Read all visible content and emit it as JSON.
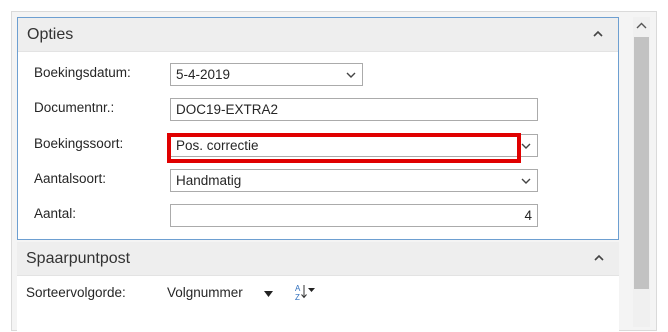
{
  "opties": {
    "title": "Opties",
    "fields": {
      "boekingsdatum": {
        "label": "Boekingsdatum:",
        "value": "5-4-2019"
      },
      "documentnr": {
        "label": "Documentnr.:",
        "value": "DOC19-EXTRA2"
      },
      "boekingssoort": {
        "label": "Boekingssoort:",
        "value": "Pos. correctie"
      },
      "aantalsoort": {
        "label": "Aantalsoort:",
        "value": "Handmatig"
      },
      "aantal": {
        "label": "Aantal:",
        "value": "4"
      }
    }
  },
  "spaarpuntpost": {
    "title": "Spaarpuntpost",
    "sort_label": "Sorteervolgorde:",
    "sort_value": "Volgnummer"
  },
  "icons": {
    "collapse": "chevron-up-icon",
    "dropdown": "chevron-down-icon",
    "sort_direction": "sort-az-icon",
    "scroll_up": "scroll-up-arrow-icon"
  },
  "colors": {
    "highlight": "#e00000",
    "panel_border": "#6d9fd1"
  }
}
